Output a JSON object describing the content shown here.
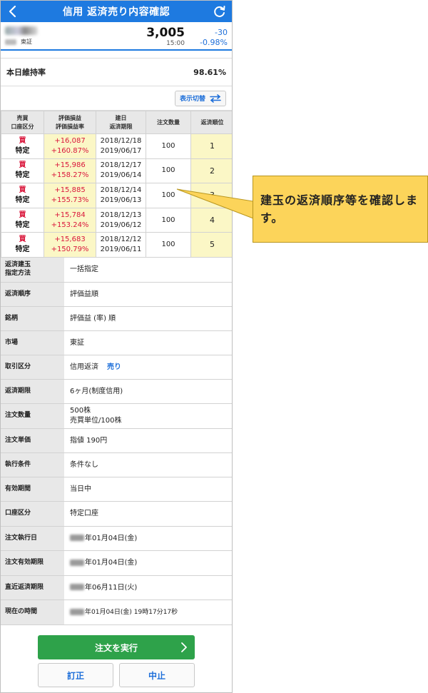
{
  "header": {
    "title": "信用 返済売り内容確認"
  },
  "stock": {
    "market": "東証",
    "price": "3,005",
    "time": "15:00",
    "change": "-30",
    "change_pct": "-0.98%"
  },
  "maintenance": {
    "label": "本日維持率",
    "value": "98.61%"
  },
  "toggle": {
    "label": "表示切替"
  },
  "table": {
    "headers": {
      "kind_1": "売買",
      "kind_2": "口座区分",
      "pl_1": "評価損益",
      "pl_2": "評価損益率",
      "date_1": "建日",
      "date_2": "返済期限",
      "qty": "注文数量",
      "rank": "返済順位"
    },
    "rows": [
      {
        "side": "買",
        "account": "特定",
        "pl": "+16,087",
        "pl_pct": "+160.87%",
        "open_date": "2018/12/18",
        "due_date": "2019/06/17",
        "qty": "100",
        "rank": "1"
      },
      {
        "side": "買",
        "account": "特定",
        "pl": "+15,986",
        "pl_pct": "+158.27%",
        "open_date": "2018/12/17",
        "due_date": "2019/06/14",
        "qty": "100",
        "rank": "2"
      },
      {
        "side": "買",
        "account": "特定",
        "pl": "+15,885",
        "pl_pct": "+155.73%",
        "open_date": "2018/12/14",
        "due_date": "2019/06/13",
        "qty": "100",
        "rank": "3"
      },
      {
        "side": "買",
        "account": "特定",
        "pl": "+15,784",
        "pl_pct": "+153.24%",
        "open_date": "2018/12/13",
        "due_date": "2019/06/12",
        "qty": "100",
        "rank": "4"
      },
      {
        "side": "買",
        "account": "特定",
        "pl": "+15,683",
        "pl_pct": "+150.79%",
        "open_date": "2018/12/12",
        "due_date": "2019/06/11",
        "qty": "100",
        "rank": "5"
      }
    ]
  },
  "details": {
    "method": {
      "k1": "返済建玉",
      "k2": "指定方法",
      "v": "一括指定"
    },
    "order": {
      "k": "返済順序",
      "v": "評価益順"
    },
    "brand": {
      "k": "銘柄",
      "v": "評価益 (率) 順"
    },
    "market": {
      "k": "市場",
      "v": "東証"
    },
    "trade": {
      "k": "取引区分",
      "v": "信用返済",
      "side": "売り"
    },
    "term": {
      "k": "返済期限",
      "v": "6ヶ月(制度信用)"
    },
    "qty": {
      "k": "注文数量",
      "v1": "500株",
      "v2": "売買単位/100株"
    },
    "price": {
      "k": "注文単価",
      "v": "指値 190円"
    },
    "cond": {
      "k": "執行条件",
      "v": "条件なし"
    },
    "valid": {
      "k": "有効期間",
      "v": "当日中"
    },
    "account": {
      "k": "口座区分",
      "v": "特定口座"
    },
    "exec_date": {
      "k": "注文執行日",
      "v": "年01月04日(金)"
    },
    "valid_until": {
      "k": "注文有効期限",
      "v": "年01月04日(金)"
    },
    "nearest_due": {
      "k": "直近返済期限",
      "v": "年06月11日(火)"
    },
    "now": {
      "k": "現在の時間",
      "v": "年01月04日(金) 19時17分17秒"
    }
  },
  "buttons": {
    "execute": "注文を実行",
    "revise": "訂正",
    "cancel": "中止"
  },
  "callout": {
    "text": "建玉の返済順序等を確認します。"
  },
  "colors": {
    "primary": "#1e7ae0",
    "buy": "#d9163b",
    "highlight": "#fbf7c6",
    "execute": "#2ea24a",
    "callout": "#fcd45a"
  }
}
